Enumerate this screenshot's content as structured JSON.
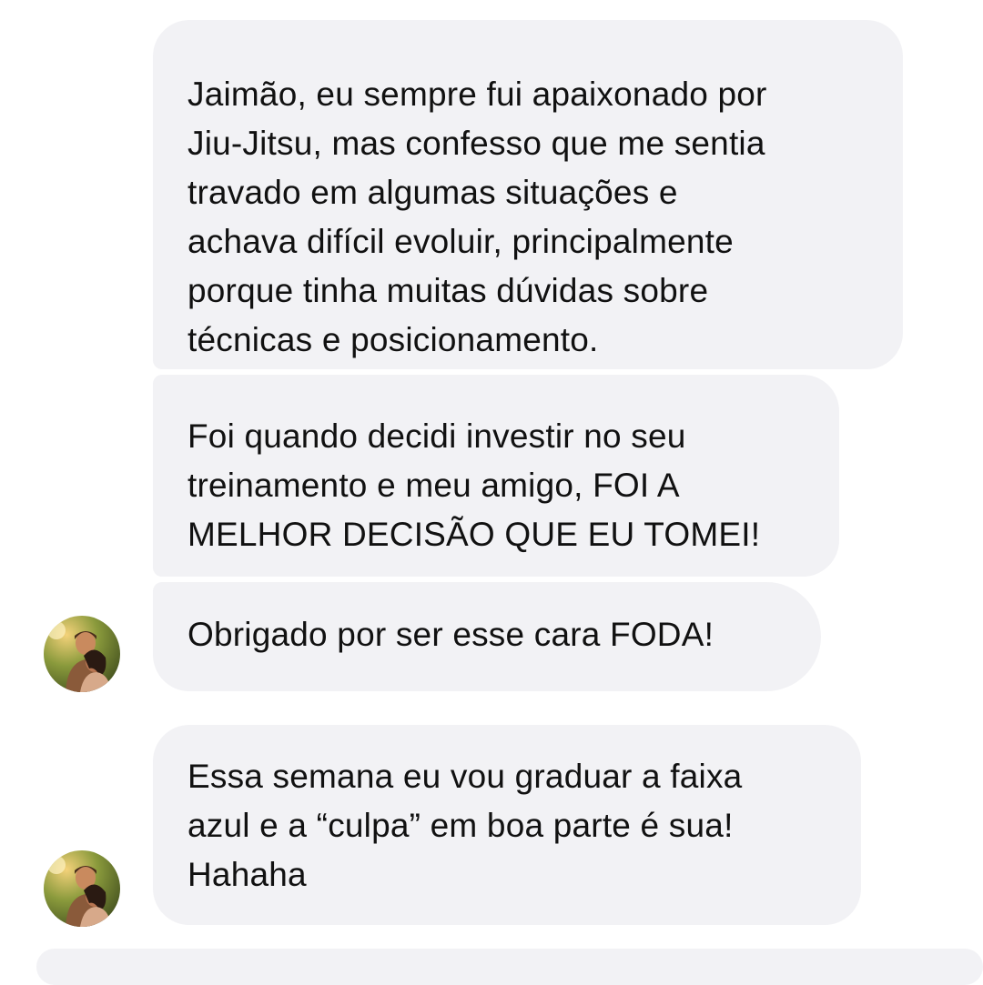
{
  "conversation": {
    "messages": [
      {
        "text": "Jaimão, eu sempre fui apaixonado por\nJiu-Jitsu, mas confesso que me sentia\ntravado em algumas situações e\nachava difícil evoluir, principalmente\nporque tinha muitas dúvidas sobre\ntécnicas e posicionamento."
      },
      {
        "text": "Foi quando decidi investir no seu\ntreinamento e meu amigo, FOI A\nMELHOR DECISÃO QUE EU TOMEI!"
      },
      {
        "text": "Obrigado por ser esse cara FODA!"
      },
      {
        "text": "Essa semana eu vou graduar a faixa\nazul e a “culpa” em boa parte é sua!\nHahaha"
      }
    ],
    "bubble_color": "#f2f2f5",
    "avatar_icon": "user-photo-avatar"
  }
}
